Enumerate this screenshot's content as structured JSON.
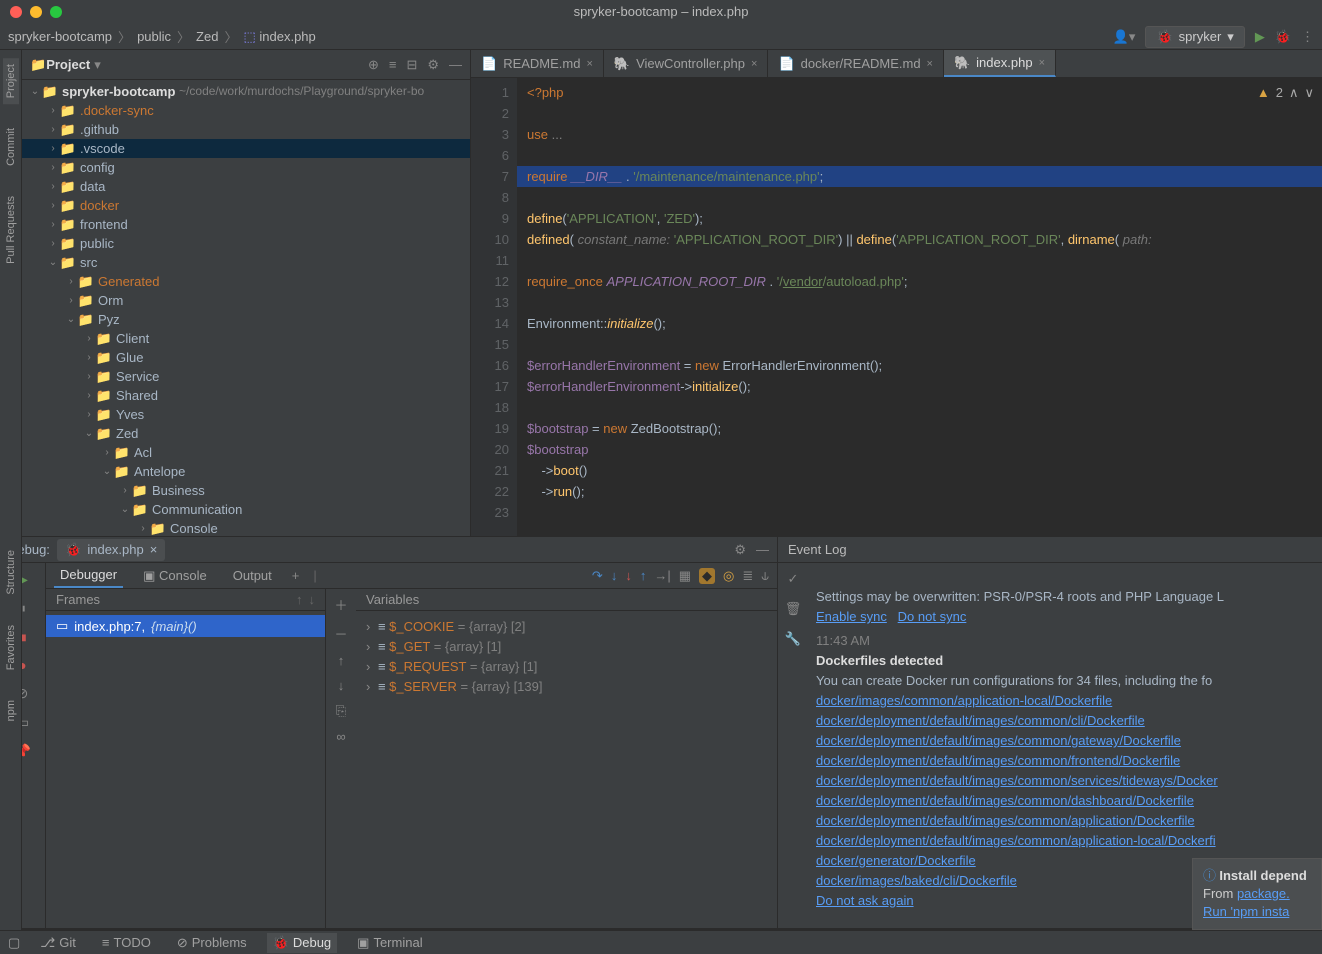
{
  "title": "spryker-bootcamp – index.php",
  "breadcrumb": [
    "spryker-bootcamp",
    "public",
    "Zed",
    "index.php"
  ],
  "run_config": "spryker",
  "project": {
    "label": "Project",
    "root": {
      "name": "spryker-bootcamp",
      "path": "~/code/work/murdochs/Playground/spryker-bo"
    },
    "items": [
      {
        "depth": 1,
        "name": ".docker-sync",
        "color": "y",
        "arr": "›"
      },
      {
        "depth": 1,
        "name": ".github",
        "arr": "›"
      },
      {
        "depth": 1,
        "name": ".vscode",
        "arr": "›",
        "sel": true
      },
      {
        "depth": 1,
        "name": "config",
        "arr": "›"
      },
      {
        "depth": 1,
        "name": "data",
        "arr": "›"
      },
      {
        "depth": 1,
        "name": "docker",
        "color": "y",
        "arr": "›"
      },
      {
        "depth": 1,
        "name": "frontend",
        "arr": "›"
      },
      {
        "depth": 1,
        "name": "public",
        "arr": "›"
      },
      {
        "depth": 1,
        "name": "src",
        "arr": "⌄"
      },
      {
        "depth": 2,
        "name": "Generated",
        "color": "y",
        "arr": "›"
      },
      {
        "depth": 2,
        "name": "Orm",
        "arr": "›"
      },
      {
        "depth": 2,
        "name": "Pyz",
        "arr": "⌄"
      },
      {
        "depth": 3,
        "name": "Client",
        "arr": "›"
      },
      {
        "depth": 3,
        "name": "Glue",
        "arr": "›"
      },
      {
        "depth": 3,
        "name": "Service",
        "arr": "›"
      },
      {
        "depth": 3,
        "name": "Shared",
        "arr": "›"
      },
      {
        "depth": 3,
        "name": "Yves",
        "arr": "›"
      },
      {
        "depth": 3,
        "name": "Zed",
        "arr": "⌄"
      },
      {
        "depth": 4,
        "name": "Acl",
        "arr": "›"
      },
      {
        "depth": 4,
        "name": "Antelope",
        "arr": "⌄"
      },
      {
        "depth": 5,
        "name": "Business",
        "arr": "›"
      },
      {
        "depth": 5,
        "name": "Communication",
        "arr": "⌄"
      },
      {
        "depth": 6,
        "name": "Console",
        "arr": "›"
      }
    ]
  },
  "tabs": [
    {
      "label": "README.md",
      "icon": "md"
    },
    {
      "label": "ViewController.php",
      "icon": "php"
    },
    {
      "label": "docker/README.md",
      "icon": "md"
    },
    {
      "label": "index.php",
      "icon": "php",
      "active": true
    }
  ],
  "warn_count": "2",
  "code_lines": [
    {
      "n": 1,
      "html": "<span class='k'>&lt;?php</span>"
    },
    {
      "n": 2,
      "html": ""
    },
    {
      "n": 3,
      "html": "<span class='k'>use</span> <span class='c'>...</span>"
    },
    {
      "n": 6,
      "html": ""
    },
    {
      "n": 7,
      "hl": true,
      "html": "<span class='k'>require</span> <span class='const'>__DIR__</span> . <span class='s'>'/maintenance/maintenance.php'</span>;"
    },
    {
      "n": 8,
      "html": ""
    },
    {
      "n": 9,
      "html": "<span class='fn'>define</span>(<span class='s'>'APPLICATION'</span>, <span class='s'>'ZED'</span>);"
    },
    {
      "n": 10,
      "html": "<span class='fn'>defined</span>( <span class='hint'>constant_name:</span> <span class='s'>'APPLICATION_ROOT_DIR'</span>) || <span class='fn'>define</span>(<span class='s'>'APPLICATION_ROOT_DIR'</span>, <span class='fn'>dirname</span>( <span class='hint'>path:</span>"
    },
    {
      "n": 11,
      "html": ""
    },
    {
      "n": 12,
      "html": "<span class='k'>require_once</span> <span class='const'>APPLICATION_ROOT_DIR</span> . <span class='s'>'/</span><span style='text-decoration:underline;color:#6a8759'>vendor</span><span class='s'>/autoload.php'</span>;"
    },
    {
      "n": 13,
      "html": ""
    },
    {
      "n": 14,
      "html": "Environment::<span class='fn' style='font-style:italic'>initialize</span>();"
    },
    {
      "n": 15,
      "html": ""
    },
    {
      "n": 16,
      "html": "<span class='var'>$errorHandlerEnvironment</span> = <span class='k'>new</span> ErrorHandlerEnvironment();"
    },
    {
      "n": 17,
      "html": "<span class='var'>$errorHandlerEnvironment</span>-><span class='fn'>initialize</span>();"
    },
    {
      "n": 18,
      "html": ""
    },
    {
      "n": 19,
      "html": "<span class='var'>$bootstrap</span> = <span class='k'>new</span> ZedBootstrap();"
    },
    {
      "n": 20,
      "html": "<span class='var'>$bootstrap</span>"
    },
    {
      "n": 21,
      "html": "    -><span class='fn'>boot</span>()"
    },
    {
      "n": 22,
      "html": "    -><span class='fn'>run</span>();"
    },
    {
      "n": 23,
      "html": ""
    }
  ],
  "debug": {
    "label": "Debug:",
    "tab": "index.php",
    "subtabs": [
      "Debugger",
      "Console",
      "Output"
    ],
    "frames_label": "Frames",
    "frame": "index.php:7, ",
    "frame_fn": "{main}()",
    "vars_label": "Variables",
    "vars": [
      {
        "name": "$_COOKIE",
        "val": " = {array} [2]"
      },
      {
        "name": "$_GET",
        "val": " = {array} [1]"
      },
      {
        "name": "$_REQUEST",
        "val": " = {array} [1]"
      },
      {
        "name": "$_SERVER",
        "val": " = {array} [139]"
      }
    ]
  },
  "event": {
    "title": "Event Log",
    "prev_tail": "Settings may be overwritten: PSR-0/PSR-4 roots and PHP Language L",
    "prev_links": [
      "Enable sync",
      "Do not sync"
    ],
    "time": "11:43 AM",
    "heading": "Dockerfiles detected",
    "body": "You can create Docker run configurations for 34 files, including the fo",
    "links": [
      "docker/images/common/application-local/Dockerfile",
      "docker/deployment/default/images/common/cli/Dockerfile",
      "docker/deployment/default/images/common/gateway/Dockerfile",
      "docker/deployment/default/images/common/frontend/Dockerfile",
      "docker/deployment/default/images/common/services/tideways/Docker",
      "docker/deployment/default/images/common/dashboard/Dockerfile",
      "docker/deployment/default/images/common/application/Dockerfile",
      "docker/deployment/default/images/common/application-local/Dockerfi",
      "docker/generator/Dockerfile",
      "docker/images/baked/cli/Dockerfile"
    ],
    "dontask": "Do not ask again"
  },
  "notif": {
    "title": "Install depend",
    "body1": "From ",
    "body1_link": "package.",
    "body2": "Run 'npm insta"
  },
  "status": {
    "git": "Git",
    "todo": "TODO",
    "problems": "Problems",
    "debug": "Debug",
    "terminal": "Terminal"
  }
}
